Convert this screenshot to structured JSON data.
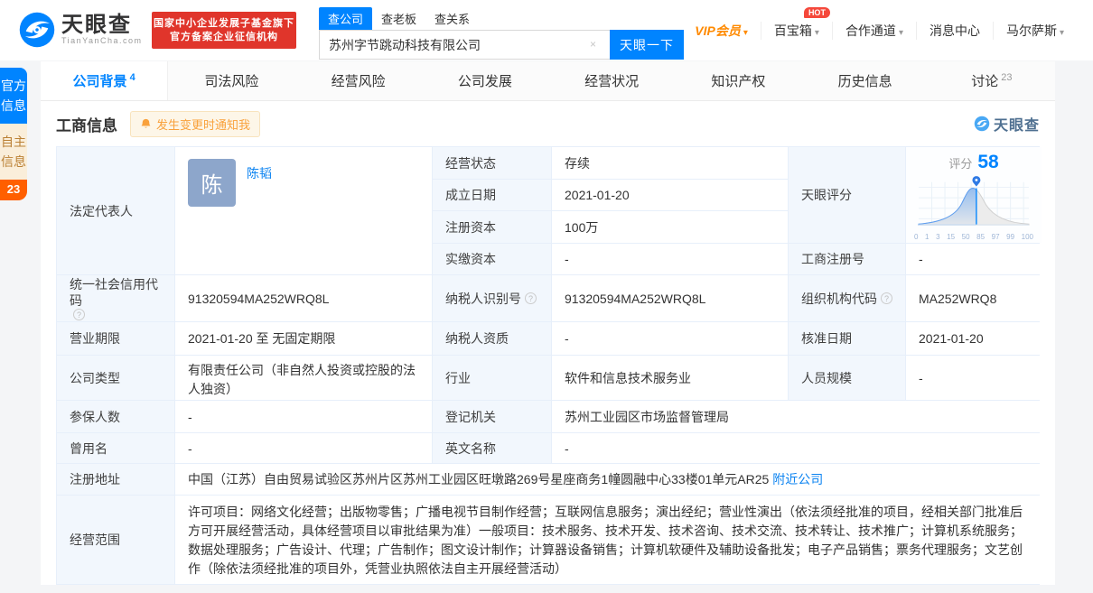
{
  "header": {
    "logo_title": "天眼查",
    "logo_domain": "TianYanCha.com",
    "badge_line1": "国家中小企业发展子基金旗下",
    "badge_line2": "官方备案企业征信机构",
    "search_tabs": [
      {
        "label": "查公司"
      },
      {
        "label": "查老板"
      },
      {
        "label": "查关系"
      }
    ],
    "search_value": "苏州字节跳动科技有限公司",
    "search_button": "天眼一下",
    "clear_icon": "×",
    "nav": [
      {
        "label": "VIP会员"
      },
      {
        "label": "百宝箱",
        "badge": "HOT"
      },
      {
        "label": "合作通道"
      },
      {
        "label": "消息中心"
      },
      {
        "label": "马尔萨斯"
      }
    ],
    "caret": "▾"
  },
  "side_tabs": {
    "official": "官方信息",
    "self": "自主信息",
    "self_count": "23"
  },
  "tabs": [
    {
      "label": "公司背景",
      "count": "4"
    },
    {
      "label": "司法风险",
      "count": ""
    },
    {
      "label": "经营风险",
      "count": ""
    },
    {
      "label": "公司发展",
      "count": ""
    },
    {
      "label": "经营状况",
      "count": ""
    },
    {
      "label": "知识产权",
      "count": ""
    },
    {
      "label": "历史信息",
      "count": ""
    },
    {
      "label": "讨论",
      "count": "23"
    }
  ],
  "section": {
    "title": "工商信息",
    "notify_button": "发生变更时通知我",
    "watermark": "天眼查"
  },
  "business_info": {
    "legal_rep_label": "法定代表人",
    "legal_rep_avatar": "陈",
    "legal_rep_name": "陈韬",
    "status_label": "经营状态",
    "status": "存续",
    "est_date_label": "成立日期",
    "est_date": "2021-01-20",
    "reg_capital_label": "注册资本",
    "reg_capital": "100万",
    "paid_capital_label": "实缴资本",
    "paid_capital": "-",
    "score_label": "天眼评分",
    "reg_no_label": "工商注册号",
    "reg_no": "-",
    "credit_code_label": "统一社会信用代码",
    "credit_code": "91320594MA252WRQ8L",
    "taxpayer_id_label": "纳税人识别号",
    "taxpayer_id": "91320594MA252WRQ8L",
    "org_code_label": "组织机构代码",
    "org_code": "MA252WRQ8",
    "term_label": "营业期限",
    "term": "2021-01-20 至 无固定期限",
    "taxpayer_quality_label": "纳税人资质",
    "taxpayer_quality": "-",
    "approval_date_label": "核准日期",
    "approval_date": "2021-01-20",
    "company_type_label": "公司类型",
    "company_type": "有限责任公司（非自然人投资或控股的法人独资）",
    "industry_label": "行业",
    "industry": "软件和信息技术服务业",
    "staff_size_label": "人员规模",
    "staff_size": "-",
    "insured_label": "参保人数",
    "insured": "-",
    "reg_authority_label": "登记机关",
    "reg_authority": "苏州工业园区市场监督管理局",
    "former_name_label": "曾用名",
    "former_name": "-",
    "english_name_label": "英文名称",
    "english_name": "-",
    "address_label": "注册地址",
    "address": "中国（江苏）自由贸易试验区苏州片区苏州工业园区旺墩路269号星座商务1幢圆融中心33楼01单元AR25",
    "nearby_link": "附近公司",
    "scope_label": "经营范围",
    "scope": "许可项目：网络文化经营；出版物零售；广播电视节目制作经营；互联网信息服务；演出经纪；营业性演出（依法须经批准的项目，经相关部门批准后方可开展经营活动，具体经营项目以审批结果为准）一般项目：技术服务、技术开发、技术咨询、技术交流、技术转让、技术推广；计算机系统服务；数据处理服务；广告设计、代理；广告制作；图文设计制作；计算器设备销售；计算机软硬件及辅助设备批发；电子产品销售；票务代理服务；文艺创作（除依法须经批准的项目外，凭营业执照依法自主开展经营活动）"
  },
  "chart_data": {
    "type": "area",
    "title": "评分",
    "score": "58",
    "ticks": [
      "0",
      "1",
      "3",
      "15",
      "50",
      "85",
      "97",
      "99",
      "100"
    ],
    "description": "天眼评分 bell-curve distribution, marker at score 58 between ticks 50 and 85",
    "colors": {
      "filled": "#5b9df2",
      "rest": "#d9d9d9",
      "marker": "#0084ff"
    }
  },
  "colors": {
    "brand_blue": "#0084ff",
    "badge_red": "#e0352b",
    "vip_orange": "#ff8a00",
    "label_bg": "#f2f7fd",
    "side_self_bg": "#faeeda",
    "side_count_bg": "#ff5f00"
  }
}
